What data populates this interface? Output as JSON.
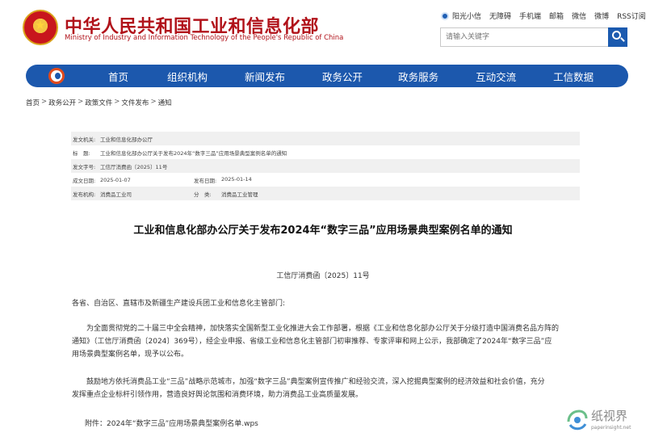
{
  "header": {
    "title": "中华人民共和国工业和信息化部",
    "subtitle": "Ministry of Industry and Information Technology of the People's Republic of China",
    "toplinks": [
      "阳光小信",
      "无障碍",
      "手机端",
      "邮箱",
      "微信",
      "微博",
      "RSS订阅"
    ],
    "search_placeholder": "请输入关键字"
  },
  "nav": {
    "items": [
      "首页",
      "组织机构",
      "新闻发布",
      "政务公开",
      "政务服务",
      "互动交流",
      "工信数据"
    ]
  },
  "breadcrumb": [
    "首页",
    "政务公开",
    "政策文件",
    "文件发布",
    "通知"
  ],
  "info": {
    "issuer_label": "发文机关:",
    "issuer": "工业和信息化部办公厅",
    "title_label": "标　题:",
    "title": "工业和信息化部办公厅关于发布2024年“数字三品”应用场景典型案例名单的通知",
    "doc_no_label": "发文字号:",
    "doc_no": "工信厅消费函〔2025〕11号",
    "date_label": "成文日期:",
    "date": "2025-01-07",
    "pub_label": "发布日期:",
    "pub_date": "2025-01-14",
    "org_label": "发布机构:",
    "org": "消费品工业司",
    "class_label": "分　类:",
    "class": "消费品工业管理"
  },
  "article": {
    "title": "工业和信息化部办公厅关于发布2024年“数字三品”应用场景典型案例名单的通知",
    "doc_number": "工信厅消费函〔2025〕11号",
    "addressee": "各省、自治区、直辖市及新疆生产建设兵团工业和信息化主管部门:",
    "para1": [
      "为全面贯彻党的二十届三中全会精神，加快落实全国新型工业化推进大会工作部署，根据《工业和信息化部办公厅关于分级打造中国消费名品方阵的",
      "通知》（工信厅消费函〔2024〕369号），经企业申报、省级工业和信息化主管部门初审推荐、专家评审和网上公示，我部确定了2024年“数字三品”应",
      "用场景典型案例名单，现予以公布。"
    ],
    "para2": [
      "鼓励地方依托消费品工业“三品”战略示范城市，加强“数字三品”典型案例宣传推广和经验交流，深入挖掘典型案例的经济效益和社会价值，充分",
      "发挥重点企业标杆引领作用，营造良好舆论氛围和消费环境，助力消费品工业高质量发展。"
    ],
    "attachment": "附件：2024年“数字三品”应用场景典型案例名单.wps"
  },
  "watermark": {
    "text": "纸视界",
    "url": "paperinsight.net"
  },
  "colors": {
    "brand_red": "#b1121a",
    "nav_blue": "#1c58ad",
    "info_shade": "#f0f0f0"
  }
}
